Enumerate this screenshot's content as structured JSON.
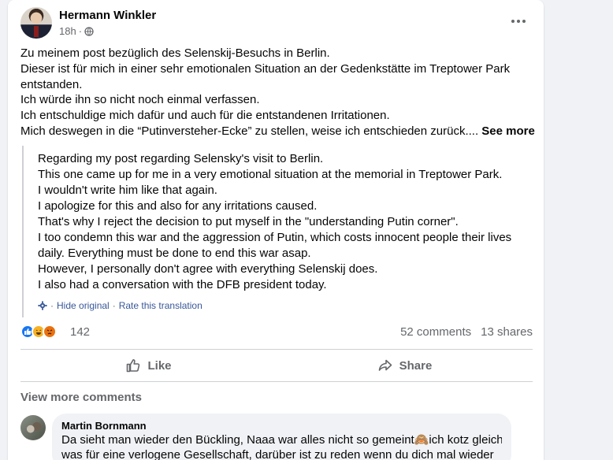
{
  "post": {
    "author": "Hermann Winkler",
    "time": "18h",
    "privacy_separator": "·",
    "original_lines": [
      "Zu meinem post bezüglich des Selenskij-Besuchs in Berlin.",
      "Dieser ist für mich in einer sehr emotionalen Situation an der Gedenkstätte im Treptower Park",
      "entstanden.",
      "Ich würde ihn so nicht noch einmal verfassen.",
      "Ich entschuldige mich dafür und auch für die entstandenen Irritationen.",
      "Mich deswegen in die “Putinversteher-Ecke” zu stellen, weise ich entschieden zurück.... "
    ],
    "see_more": "See more"
  },
  "translation": {
    "lines": [
      "Regarding my post regarding Selensky's visit to Berlin.",
      "This one came up for me in a very emotional situation at the memorial in Treptower Park.",
      "I wouldn't write him like that again.",
      "I apologize for this and also for any irritations caused.",
      "That's why I reject the decision to put myself in the \"understanding Putin corner\".",
      "I too condemn this war and the aggression of Putin, which costs innocent people their lives",
      "daily. Everything must be done to end this war asap.",
      "However, I personally don't agree with everything Selenskij does.",
      "I also had a conversation with the DFB president today."
    ],
    "hide_original": "Hide original",
    "rate": "Rate this translation",
    "sep": "·"
  },
  "stats": {
    "reaction_count": "142",
    "comments": "52 comments",
    "shares": "13 shares",
    "reaction_icons": [
      "like-icon",
      "haha-icon",
      "angry-icon"
    ]
  },
  "actions": {
    "like": "Like",
    "share": "Share"
  },
  "comments": {
    "view_more": "View more comments",
    "items": [
      {
        "author": "Martin Bornmann",
        "line1": "Da sieht man wieder den Bückling, Naaa war alles nicht so gemeint🙈ich kotz gleich,",
        "line2": "was für eine verlogene Gesellschaft, darüber ist zu reden wenn du dich mal wieder"
      }
    ]
  },
  "colors": {
    "background": "#f0f2f5",
    "card": "#ffffff",
    "muted": "#65676b",
    "link": "#385898",
    "like_blue": "#1877f2"
  }
}
